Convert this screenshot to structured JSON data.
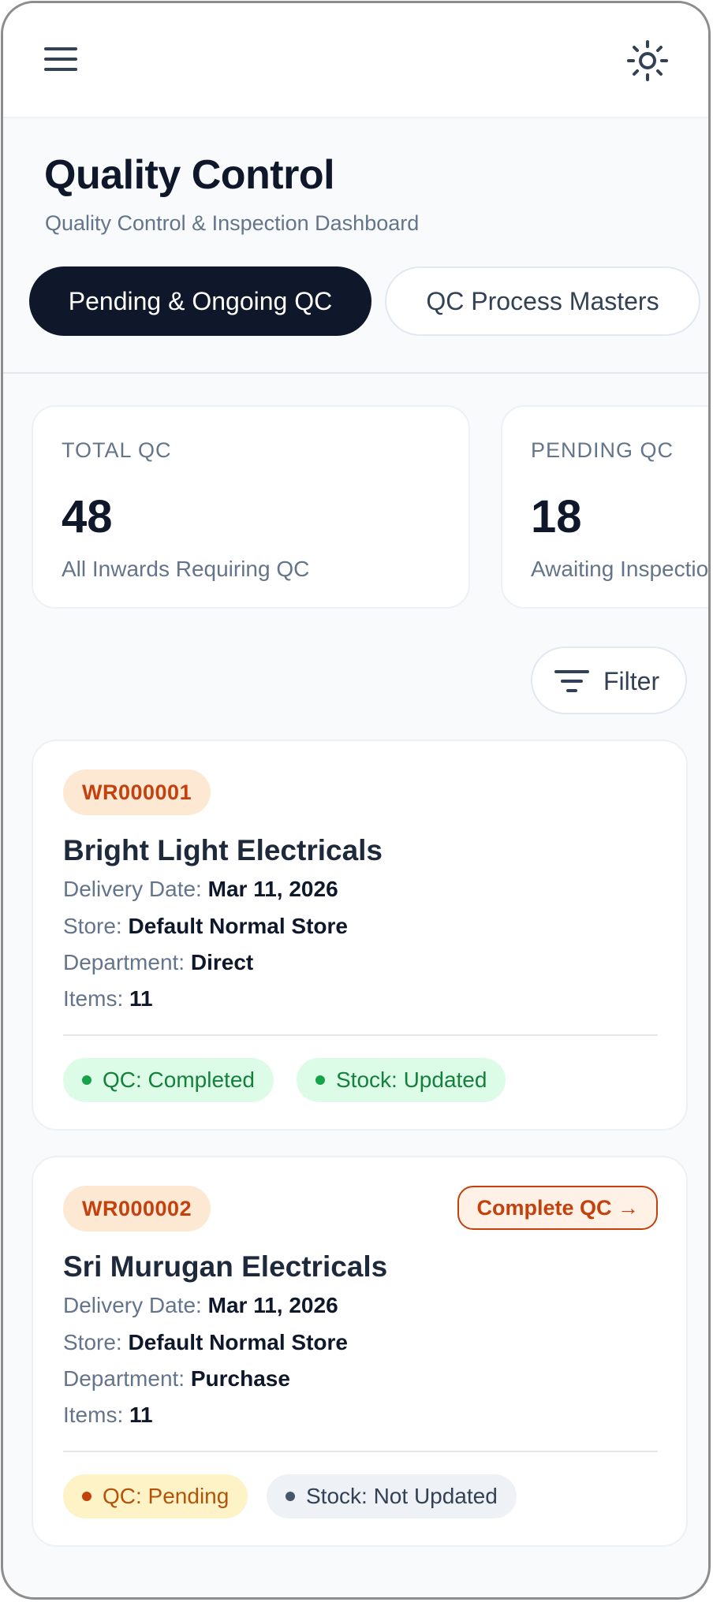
{
  "header": {
    "menu_icon": "hamburger-menu-icon",
    "theme_icon": "sun-icon"
  },
  "page": {
    "title": "Quality Control",
    "subtitle": "Quality Control & Inspection Dashboard"
  },
  "tabs": [
    {
      "label": "Pending & Ongoing QC",
      "active": true
    },
    {
      "label": "QC Process Masters",
      "active": false
    }
  ],
  "stats": [
    {
      "label": "TOTAL QC",
      "value": "48",
      "description": "All Inwards Requiring QC"
    },
    {
      "label": "PENDING QC",
      "value": "18",
      "description": "Awaiting Inspection"
    }
  ],
  "filter": {
    "label": "Filter",
    "icon": "filter-lines-icon"
  },
  "colors": {
    "primary": "#0f172a",
    "accent_orange": "#c2410c",
    "success_green": "#15803d",
    "pending_amber": "#b45309"
  },
  "labels": {
    "delivery_date": "Delivery Date:",
    "store": "Store:",
    "department": "Department:",
    "items": "Items:"
  },
  "records": [
    {
      "id": "WR000001",
      "vendor": "Bright Light Electricals",
      "delivery_date": "Mar 11, 2026",
      "store": "Default Normal Store",
      "department": "Direct",
      "items": "11",
      "qc_status": "QC: Completed",
      "stock_status": "Stock: Updated",
      "action": null
    },
    {
      "id": "WR000002",
      "vendor": "Sri Murugan Electricals",
      "delivery_date": "Mar 11, 2026",
      "store": "Default Normal Store",
      "department": "Purchase",
      "items": "11",
      "qc_status": "QC: Pending",
      "stock_status": "Stock: Not Updated",
      "action": "Complete QC →"
    }
  ]
}
